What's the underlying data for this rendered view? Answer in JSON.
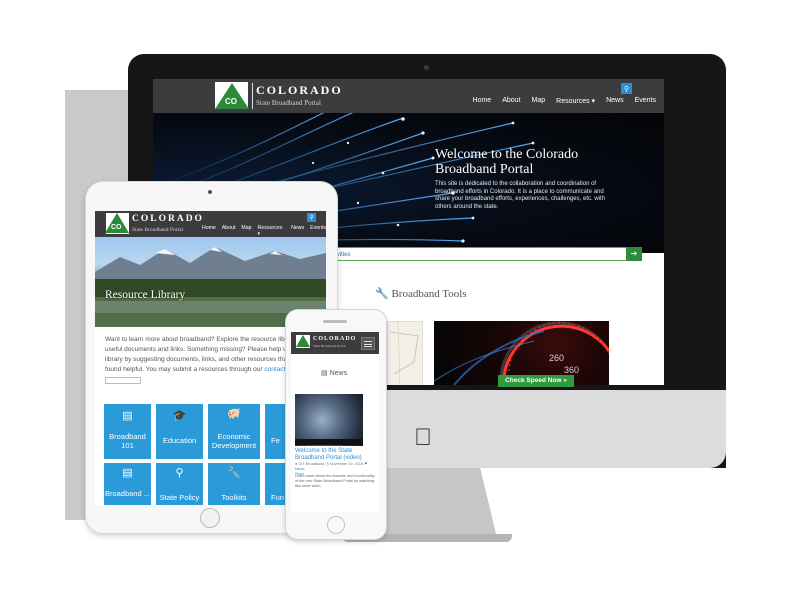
{
  "brand": {
    "logo_badge": "CO",
    "title": "COLORADO",
    "subtitle": "State Broadband Portal"
  },
  "desktop": {
    "nav": [
      "Home",
      "About",
      "Map",
      "Resources",
      "News",
      "Events"
    ],
    "hero": {
      "title": "Welcome to the Colorado Broadband Portal",
      "body": "This site is dedicated to the collaboration and coordination of broadband efforts in Colorado. It is a place to communicate and share your broadband efforts, experiences, challenges, etc. with others around the state."
    },
    "ticker": "d Board and Fund website for updated information about Board activities",
    "tools_heading": "Broadband Tools",
    "speed_button": "Check Speed Now »"
  },
  "tablet": {
    "nav": [
      "Home",
      "About",
      "Map",
      "Resources",
      "News",
      "Events"
    ],
    "banner_title": "Resource Library",
    "intro": {
      "line1": "Want to learn more about broadband?  Explore the resource libra",
      "line2": "useful documents and links. Something missing?  Please help us b",
      "line3": "library by suggesting documents, links, and other resources that y",
      "line4": "found helpful.  You may submit a resources through our ",
      "link": "contact p"
    },
    "tiles": [
      {
        "icon": "document-icon",
        "label": "Broadband 101"
      },
      {
        "icon": "graduation-cap-icon",
        "label": "Education"
      },
      {
        "icon": "piggy-bank-icon",
        "label": "Economic Development"
      },
      {
        "icon": "partial-icon",
        "label": "Fe"
      },
      {
        "icon": "document-icon",
        "label": "Broadband ..."
      },
      {
        "icon": "map-pin-icon",
        "label": "State Policy"
      },
      {
        "icon": "wrench-icon",
        "label": "Toolkits"
      },
      {
        "icon": "partial-icon",
        "label": "Fun"
      }
    ]
  },
  "phone": {
    "section_title": "News",
    "post_link": "Welcome to the State Broadband Portal (video)",
    "meta_author": "OIT Broadband",
    "meta_date": "November 10, 2015",
    "meta_category": "News",
    "meta_story": "Story",
    "excerpt": "Learn more about the features and functionality of the new State Broadband Portal by watching this short video."
  },
  "colors": {
    "nav_bg": "#3c3c3e",
    "accent_blue": "#2a9ad8",
    "accent_green": "#2e8b3c",
    "logo_green": "#2a8a3a"
  }
}
